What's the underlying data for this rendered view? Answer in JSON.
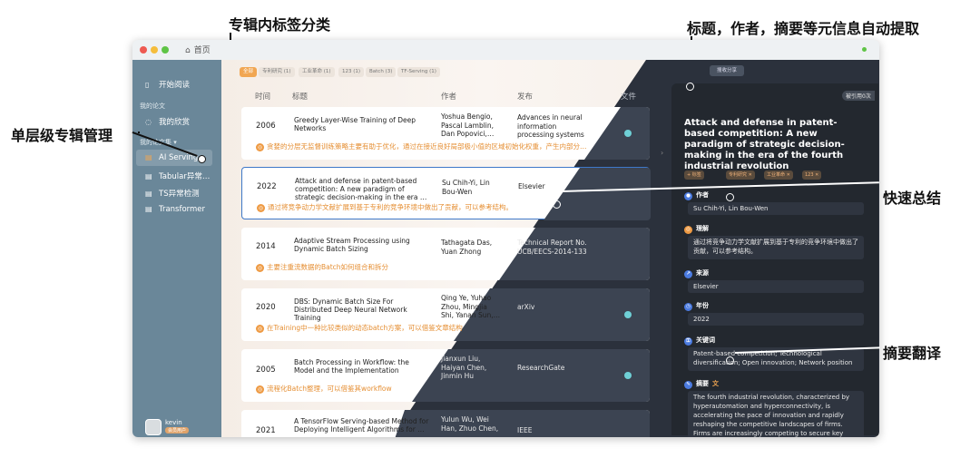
{
  "callouts": {
    "top_left": "专辑内标签分类",
    "top_right": "标题，作者，摘要等元信息自动提取",
    "left": "单层级专辑管理",
    "right1": "快速总结",
    "right2": "摘要翻译"
  },
  "window": {
    "home_label": "首页"
  },
  "sidebar": {
    "start_reading": "开始阅读",
    "my_papers": "我的论文",
    "my_favorites": "我的欣赏",
    "my_collections": "我的论文集 ▾",
    "items": [
      "AI Serving",
      "Tabular异常…",
      "TS异常检测",
      "Transformer"
    ],
    "user": {
      "name": "kevin",
      "badge": "会员用户"
    }
  },
  "tabs": [
    "全部",
    "专利研究 (1)",
    "工业革命 (1)",
    "123 (1)",
    "Batch (3)",
    "TF-Serving (1)"
  ],
  "search_button": "搜收分享",
  "columns": {
    "time": "时间",
    "title": "标题",
    "author": "作者",
    "venue": "发布",
    "file": "文件"
  },
  "papers": [
    {
      "year": "2006",
      "title": "Greedy Layer-Wise Training of Deep Networks",
      "authors": "Yoshua Bengio, Pascal Lamblin, Dan Popovici,…",
      "venue": "Advances in neural information processing systems",
      "note": "贪婪的分层无监督训练策略主要有助于优化，通过在接近良好局部极小值的区域初始化权重，产生内部分…"
    },
    {
      "year": "2022",
      "title": "Attack and defense in patent-based competition: A new paradigm of strategic decision-making in the era …",
      "authors": "Su Chih-Yi, Lin Bou-Wen",
      "venue": "Elsevier",
      "note": "通过将竞争动力学文献扩展到基于专利的竞争环境中做出了贡献，可以参考结构。"
    },
    {
      "year": "2014",
      "title": "Adaptive Stream Processing using Dynamic Batch Sizing",
      "authors": "Tathagata Das, Yuan Zhong",
      "venue": "Technical Report No. UCB/EECS-2014-133",
      "note": "主要注重流数据的Batch如何组合和拆分"
    },
    {
      "year": "2020",
      "title": "DBS: Dynamic Batch Size For Distributed Deep Neural Network Training",
      "authors": "Qing Ye, Yuhao Zhou, Mingjia Shi, Yanan Sun,…",
      "venue": "arXiv",
      "note": "在Training中一种比较类似的动态batch方案，可以借鉴文章结构"
    },
    {
      "year": "2005",
      "title": "Batch Processing in Workflow: the Model and the Implementation",
      "authors": "Jianxun Liu, Haiyan Chen, Jinmin Hu",
      "venue": "ResearchGate",
      "note": "流程化Batch整理，可以借鉴其workflow"
    },
    {
      "year": "2021",
      "title": "A TensorFlow Serving-based Method for Deploying Intelligent Algorithms for …",
      "authors": "Yulun Wu, Wei Han, Zhuo Chen, …",
      "venue": "IEEE",
      "note": ""
    }
  ],
  "detail": {
    "cite_badge": "被引用0次",
    "title": "Attack and defense in patent-based competition: A new paradigm of strategic decision-making in the era of the fourth industrial revolution",
    "add_tag": "+ 标签",
    "tags": [
      "专利研究 ✕",
      "工业革命 ✕",
      "123 ✕"
    ],
    "author_label": "作者",
    "author_value": "Su Chih-Yi, Lin Bou-Wen",
    "summary_label": "理解",
    "summary_value": "通过将竞争动力学文献扩展到基于专利的竞争环境中做出了贡献，可以参考结构。",
    "source_label": "来源",
    "source_value": "Elsevier",
    "year_label": "年份",
    "year_value": "2022",
    "keywords_label": "关键词",
    "keywords_value": "Patent-based competition; Technological diversification; Open innovation; Network position",
    "abstract_label": "摘要",
    "abstract_value": "The fourth industrial revolution, characterized by hyperautomation and hyperconnectivity, is accelerating the pace of innovation and rapidly reshaping the competitive landscapes of firms. Firms are increasingly competing to secure key resources, such as patents. Patent-based"
  },
  "colors": {
    "sidebar": "#6a8799",
    "accent_orange": "#f1a652",
    "note_orange": "#e58e32",
    "file_dot": "#6fd0d6",
    "dark_panel": "#23282f",
    "selected_border": "#3e78c8"
  }
}
